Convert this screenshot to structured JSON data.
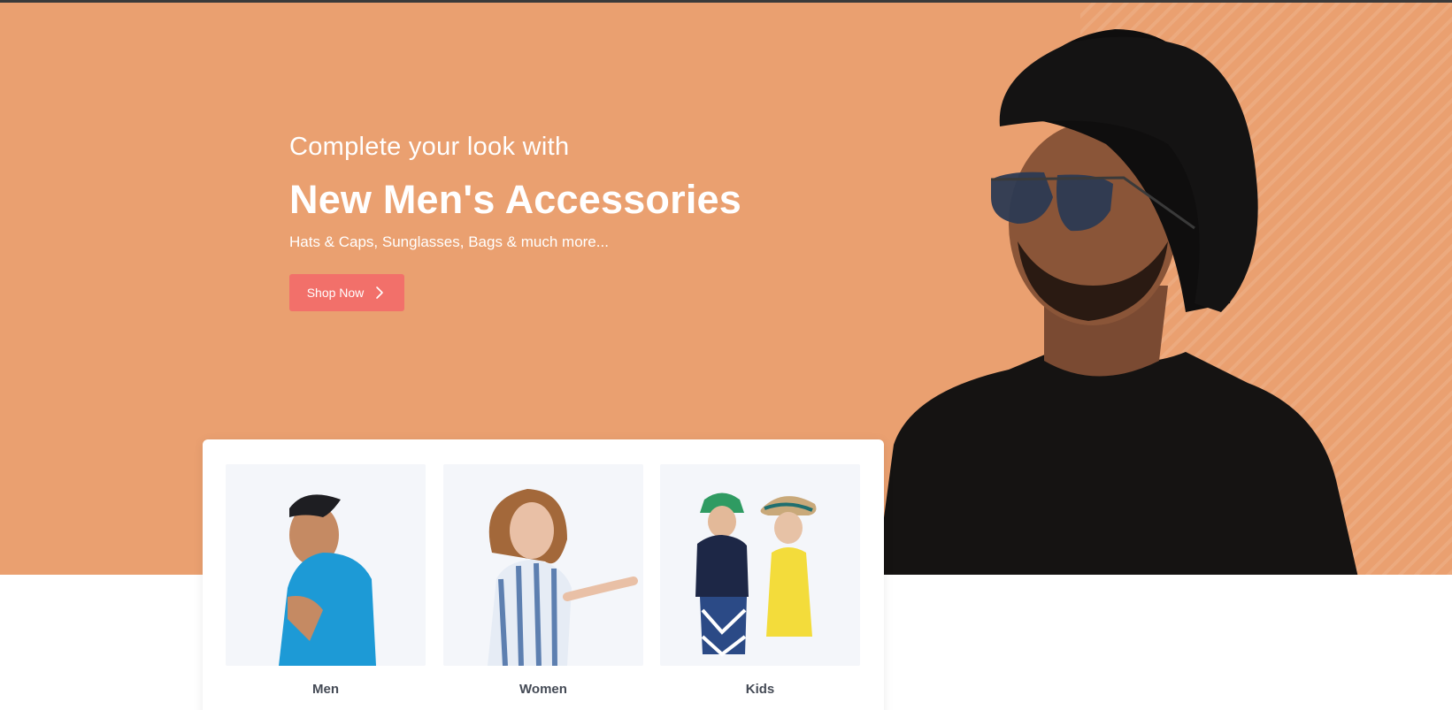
{
  "hero": {
    "pre_title": "Complete your look with",
    "title": "New Men's Accessories",
    "subtitle": "Hats & Caps, Sunglasses, Bags & much more...",
    "button_label": "Shop Now",
    "button_icon": "chevron-right-icon",
    "background_color": "#eaa070",
    "button_color": "#f2706a"
  },
  "categories": [
    {
      "label": "Men"
    },
    {
      "label": "Women"
    },
    {
      "label": "Kids"
    }
  ]
}
